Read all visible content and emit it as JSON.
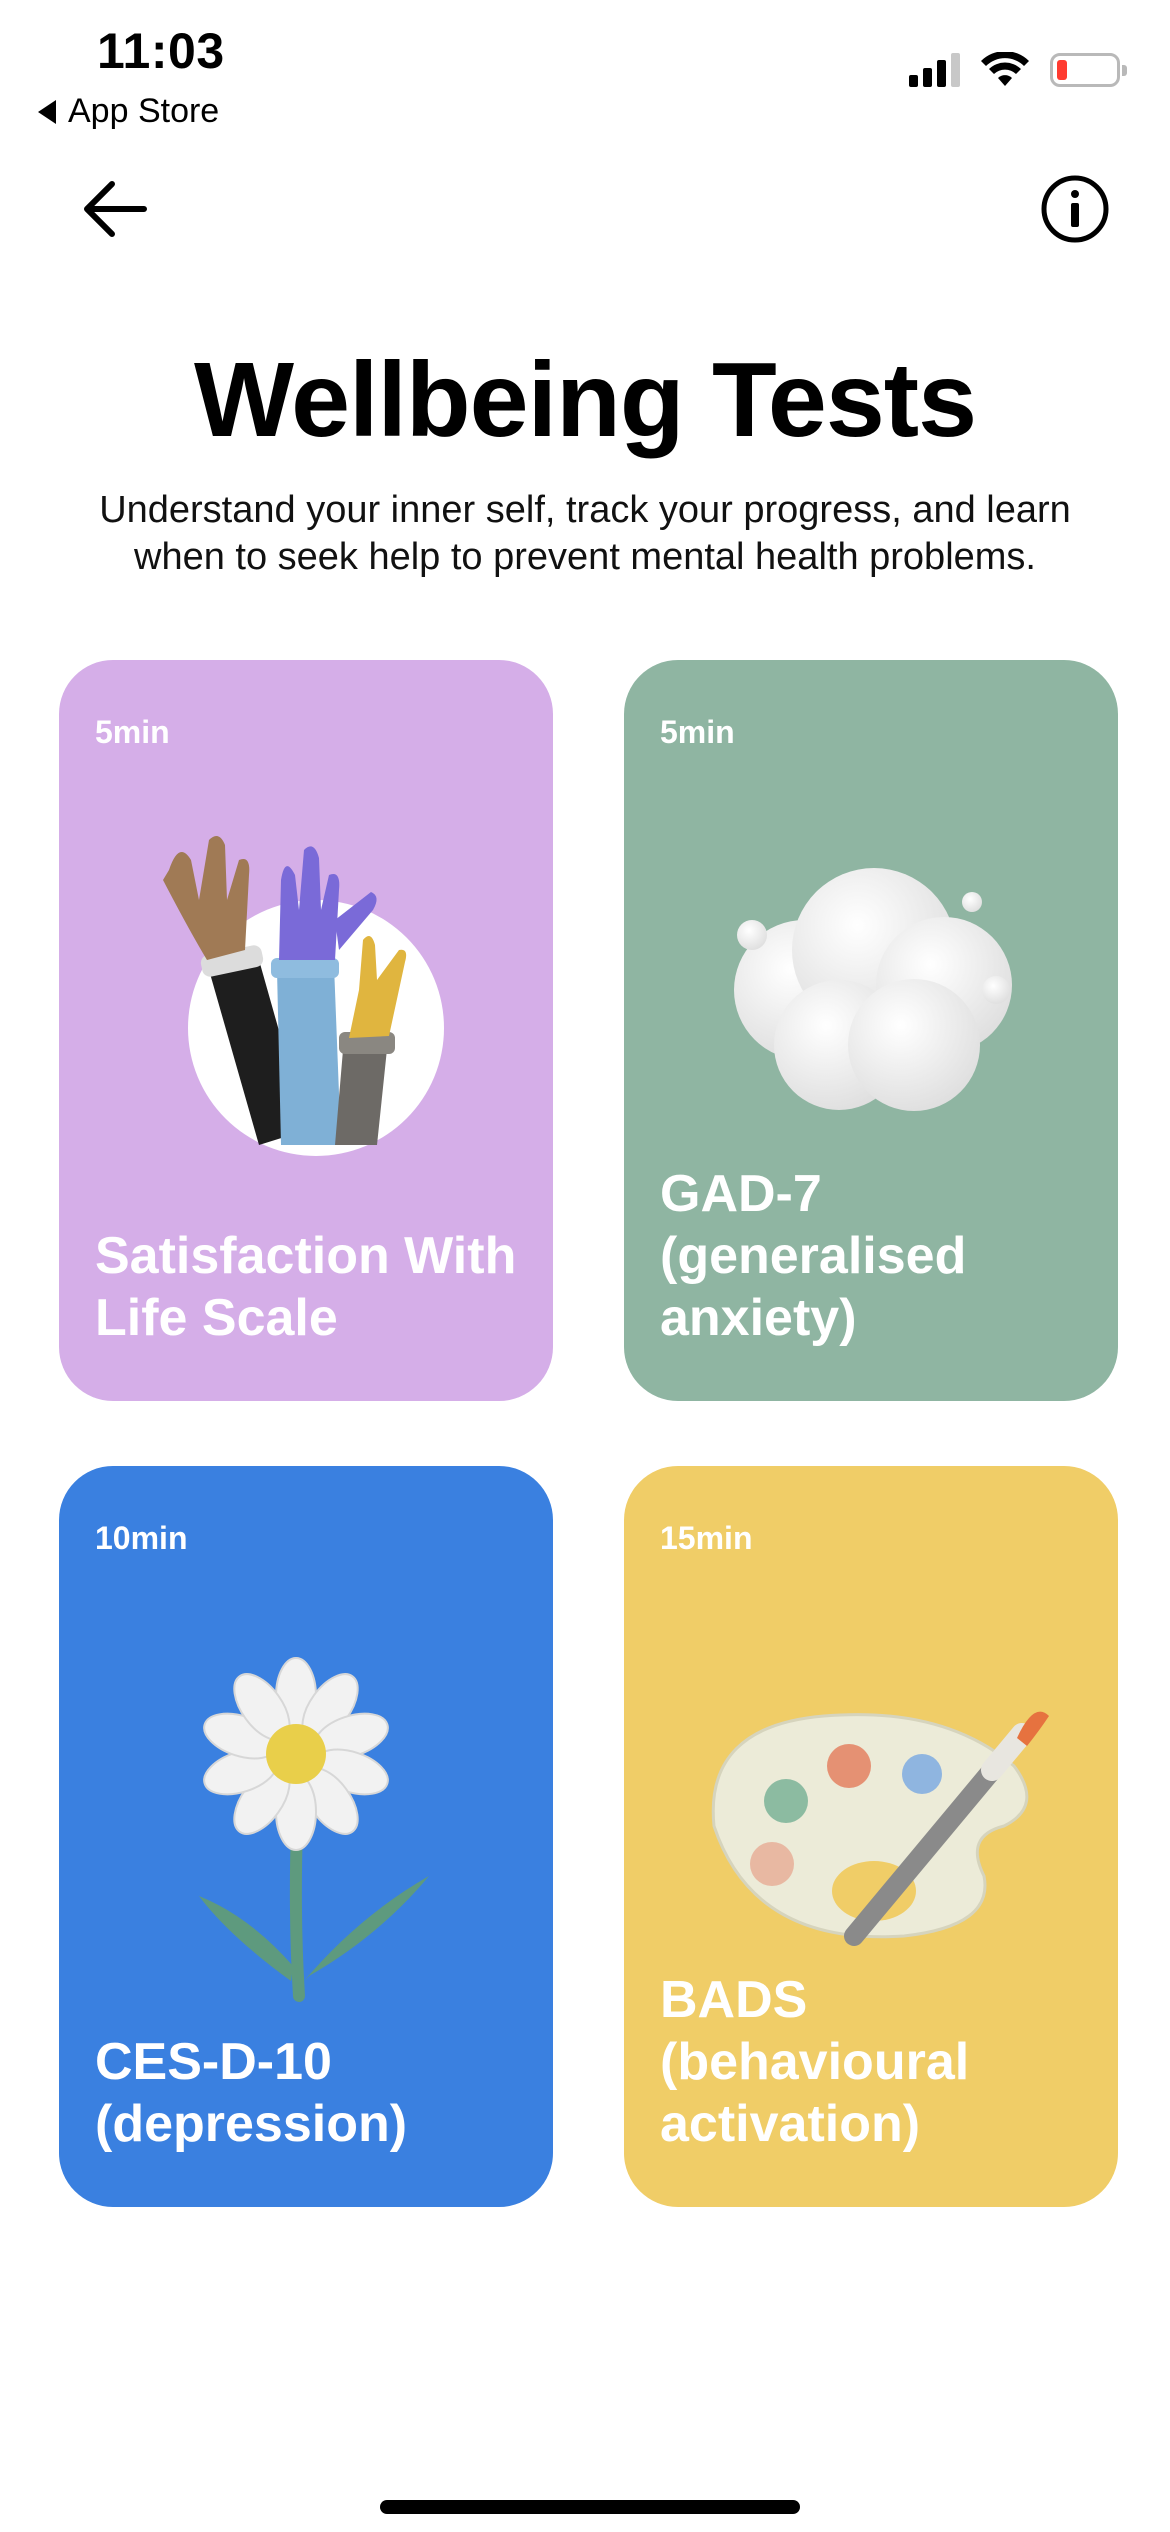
{
  "status_bar": {
    "time": "11:03",
    "back_label": "App Store",
    "icons": [
      "cellular-signal-icon",
      "wifi-icon",
      "battery-low-icon"
    ]
  },
  "nav": {
    "back_icon": "arrow-left-icon",
    "info_icon": "info-icon"
  },
  "header": {
    "title": "Wellbeing Tests",
    "subtitle": "Understand your inner self, track your progress, and learn when to seek help to prevent mental health problems."
  },
  "tests": [
    {
      "duration": "5min",
      "title": "Satisfaction With Life Scale",
      "color": "#d5aee8",
      "illustration": "raised-hands-illustration"
    },
    {
      "duration": "5min",
      "title": "GAD-7 (generalised anxiety)",
      "color": "#8fb5a2",
      "illustration": "cloud-illustration"
    },
    {
      "duration": "10min",
      "title": "CES-D-10 (depression)",
      "color": "#3a80e0",
      "illustration": "daisy-flower-illustration"
    },
    {
      "duration": "15min",
      "title": "BADS (behavioural activation)",
      "color": "#f0cd67",
      "illustration": "paint-palette-illustration"
    }
  ]
}
